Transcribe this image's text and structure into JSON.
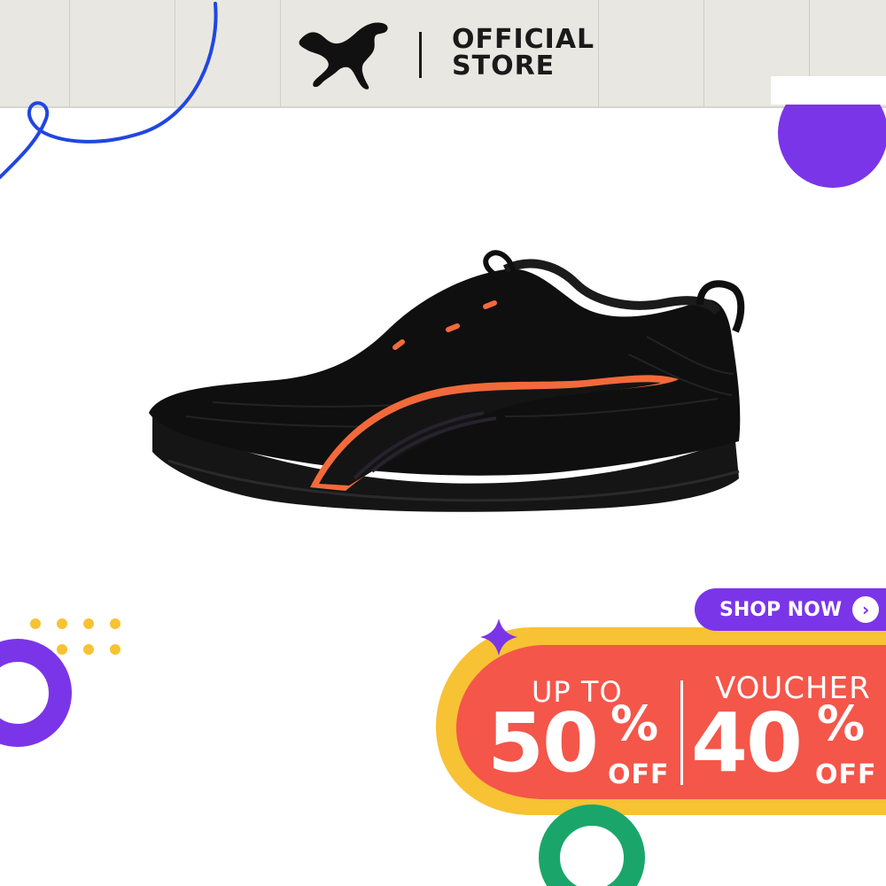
{
  "header": {
    "brand": "PUMA",
    "logo_icon": "puma-cat-logo",
    "store_line1": "OFFICIAL",
    "store_line2": "STORE",
    "background": "#e8e7e1"
  },
  "product": {
    "image": "black-running-shoe-with-orange-accents",
    "shoe_color": "#111111",
    "accent_color": "#f26a3b"
  },
  "promo": {
    "shop_now_label": "SHOP NOW",
    "shop_now_icon": "chevron-right-icon",
    "left_top": "UP TO",
    "left_value": "50",
    "left_pct": "%",
    "left_off": "OFF",
    "right_top": "VOUCHER",
    "right_value": "40",
    "right_pct": "%",
    "right_off": "OFF",
    "banner_color": "#f4564a",
    "banner_outer_color": "#f7c234",
    "button_color": "#7b35e8"
  },
  "decorations": {
    "colors": {
      "purple": "#7b35e8",
      "blue": "#2146e0",
      "yellow": "#f7c234",
      "green": "#1aa66a"
    }
  }
}
